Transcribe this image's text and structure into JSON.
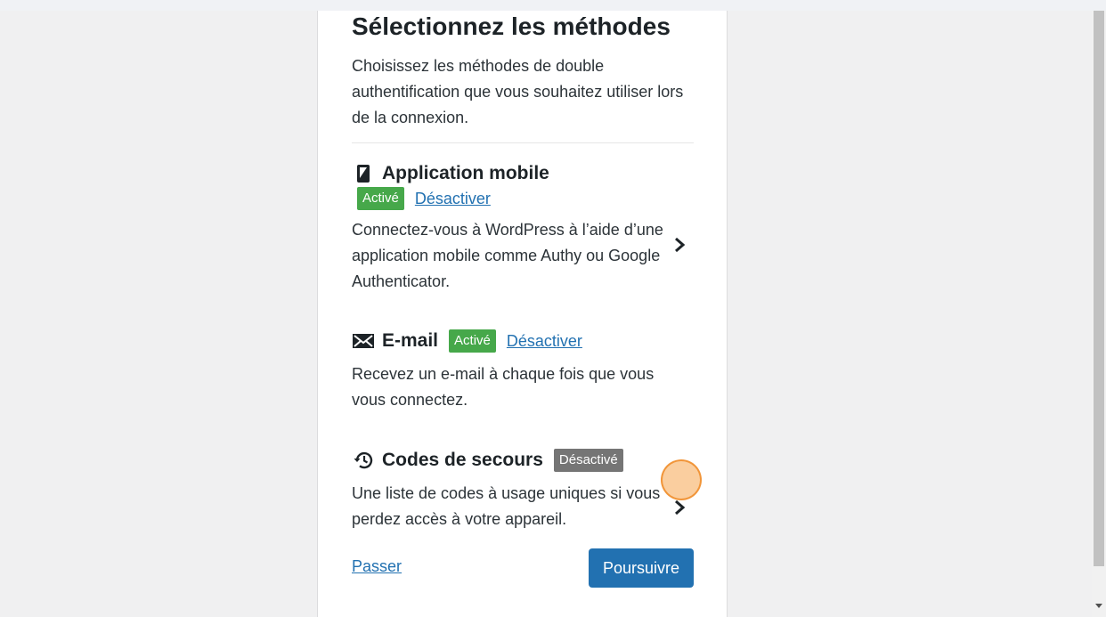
{
  "page": {
    "title": "Sélectionnez les méthodes",
    "intro": "Choisissez les méthodes de double authentification que vous souhaitez utiliser lors de la connexion."
  },
  "methods": [
    {
      "icon": "mobile-phone-icon",
      "title": "Application mobile",
      "status": "Activé",
      "action": "Désactiver",
      "description": "Connectez-vous à WordPress à l’aide d’une application mobile comme Authy ou Google Authenticator."
    },
    {
      "icon": "envelope-icon",
      "title": "E-mail",
      "status": "Activé",
      "action": "Désactiver",
      "description": "Recevez un e-mail à chaque fois que vous vous connectez."
    },
    {
      "icon": "history-icon",
      "title": "Codes de secours",
      "status": "Désactivé",
      "description": "Une liste de codes à usage uniques si vous perdez accès à votre appareil."
    }
  ],
  "footer": {
    "skip_label": "Passer",
    "continue_label": "Poursuivre"
  },
  "colors": {
    "accent": "#2271b1",
    "active_badge": "#46a84a",
    "inactive_badge": "#757575",
    "click_highlight": "#f5a650"
  }
}
